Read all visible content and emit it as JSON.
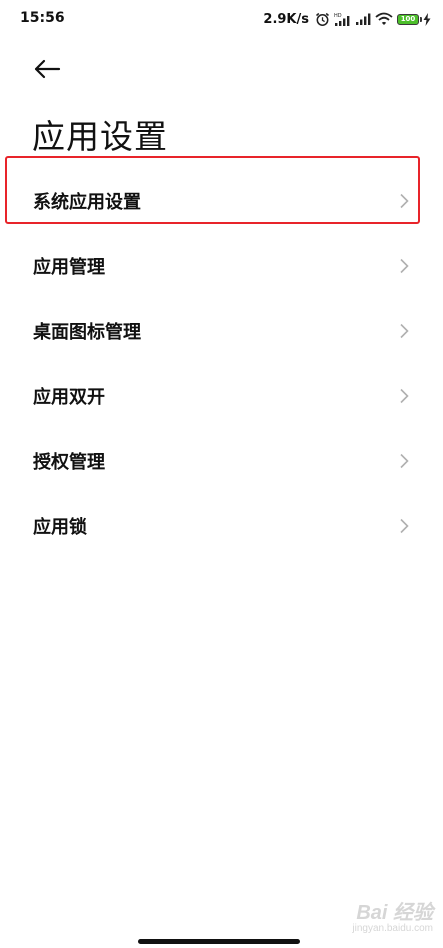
{
  "status_bar": {
    "time": "15:56",
    "net_speed": "2.9K/s",
    "battery": "100",
    "icons": [
      "alarm-icon",
      "hd-signal-icon",
      "signal-icon",
      "wifi-icon",
      "battery-icon",
      "charging-icon"
    ]
  },
  "header": {
    "back_icon": "arrow-left-icon",
    "title": "应用设置"
  },
  "menu": {
    "items": [
      {
        "label": "系统应用设置",
        "highlighted": true
      },
      {
        "label": "应用管理"
      },
      {
        "label": "桌面图标管理"
      },
      {
        "label": "应用双开"
      },
      {
        "label": "授权管理"
      },
      {
        "label": "应用锁"
      }
    ],
    "chevron_icon": "chevron-right-icon"
  },
  "watermark": {
    "main": "Bai 经验",
    "sub": "jingyan.baidu.com"
  },
  "colors": {
    "highlight": "#e8242a",
    "battery": "#4cbf2a",
    "chevron": "#b0b0b0",
    "text": "#111111"
  }
}
